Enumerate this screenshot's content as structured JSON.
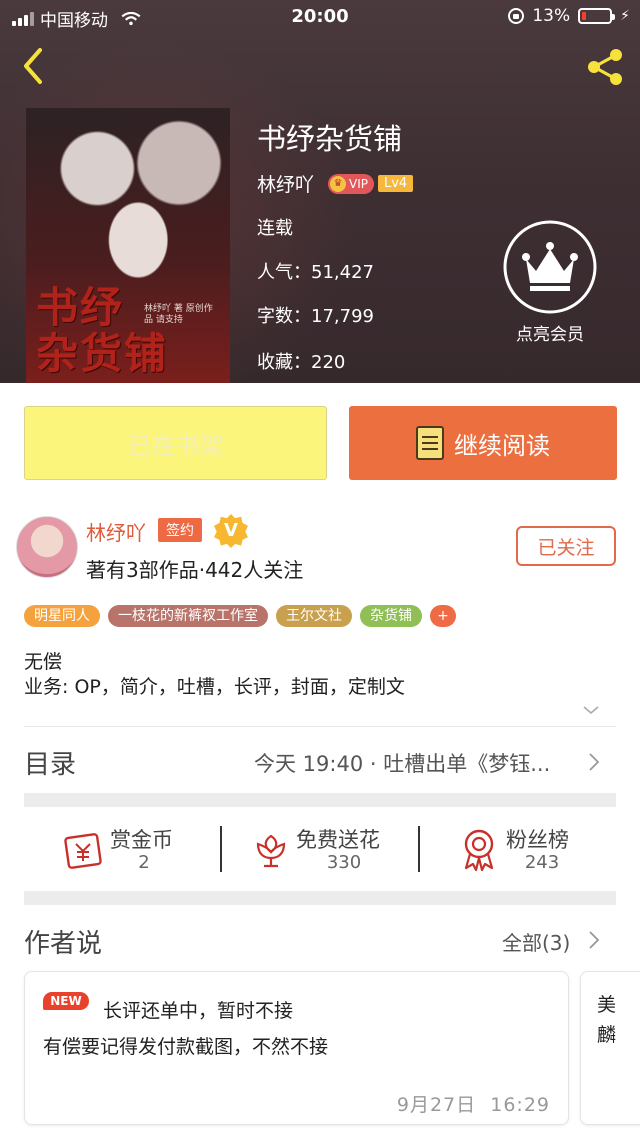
{
  "status_bar": {
    "carrier": "中国移动",
    "time": "20:00",
    "battery": "13%"
  },
  "book": {
    "title": "书纾杂货铺",
    "author": "林纾吖",
    "vip_label": "VIP",
    "level": "Lv4",
    "status": "连载",
    "popularity_label": "人气：",
    "popularity": "51,427",
    "words_label": "字数：",
    "words": "17,799",
    "favorites_label": "收藏：",
    "favorites": "220",
    "cover_title_line1": "书纾",
    "cover_title_line2": "杂货铺",
    "cover_subtitle": "林纾吖 著 原创作品 请支持"
  },
  "membership": {
    "label": "点亮会员"
  },
  "actions": {
    "shelf_label": "已在书架",
    "read_label": "继续阅读"
  },
  "author_block": {
    "name": "林纾吖",
    "sign_label": "签约",
    "v_label": "V",
    "stats": "著有3部作品·442人关注",
    "follow_label": "已关注"
  },
  "tags": [
    {
      "label": "明星同人",
      "color": "#f3a23e"
    },
    {
      "label": "一枝花的新裤衩工作室",
      "color": "#b8746a"
    },
    {
      "label": "王尔文社",
      "color": "#c9a14e"
    },
    {
      "label": "杂货铺",
      "color": "#8fbf55"
    }
  ],
  "tag_plus": "+",
  "description": {
    "line1": "无偿",
    "line2": "业务: OP，简介，吐槽，长评，封面，定制文"
  },
  "catalog": {
    "label": "目录",
    "latest": "今天 19:40 · 吐槽出单《梦钰..."
  },
  "stats_row": [
    {
      "label": "赏金币",
      "value": "2"
    },
    {
      "label": "免费送花",
      "value": "330"
    },
    {
      "label": "粉丝榜",
      "value": "243"
    }
  ],
  "author_says": {
    "title": "作者说",
    "all_label": "全部(3)",
    "notes": [
      {
        "badge": "NEW",
        "line1": "长评还单中，暂时不接",
        "line2": "有偿要记得发付款截图，不然不接",
        "date": "9月27日",
        "time": "16:29"
      }
    ],
    "peek_text": "美麟"
  },
  "colors": {
    "accent": "#ec6f40",
    "shelf_button": "#fcf57c",
    "header_bg": "#3e2f33"
  }
}
